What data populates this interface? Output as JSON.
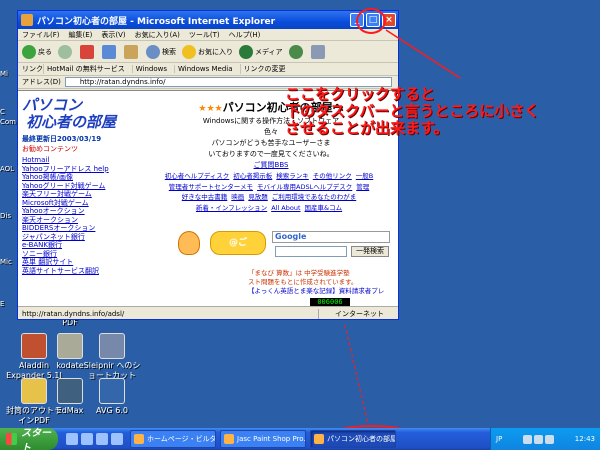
{
  "desktop": {
    "edge_labels": [
      "Mi",
      "C",
      "Com",
      "AOL",
      "Dis",
      "Mic",
      "E"
    ],
    "icons": [
      {
        "label": "Aladdin\nExpander 5.1J",
        "color": "#c05030"
      },
      {
        "label": "kodate",
        "color": "#aaaa99"
      },
      {
        "label": "Sleipnir へのシ\nョートカット",
        "color": "#7788aa"
      },
      {
        "label": "封筒のアウトラ\nインPDF",
        "color": "#e6c24a"
      },
      {
        "label": "EdMax",
        "color": "#406080"
      },
      {
        "label": "AVG 6.0",
        "color": "#3366aa"
      },
      {
        "label": "PDF",
        "color": "#cc3333"
      }
    ]
  },
  "window": {
    "title": "パソコン初心者の部屋 - Microsoft Internet Explorer",
    "minimize": "_",
    "maximize": "□",
    "close": "×",
    "menus": [
      "ファイル(F)",
      "編集(E)",
      "表示(V)",
      "お気に入り(A)",
      "ツール(T)",
      "ヘルプ(H)"
    ],
    "toolbar": {
      "back": "戻る",
      "search": "検索",
      "favorites": "お気に入り",
      "media": "メディア"
    },
    "links_label": "リンク",
    "links": [
      "HotMail の無料サービス",
      "Windows",
      "Windows Media",
      "リンクの変更"
    ],
    "address_label": "アドレス(D)",
    "address": "http://ratan.dyndns.info/",
    "status_url": "http://ratan.dyndns.info/adsl/",
    "status_zone": "インターネット"
  },
  "page": {
    "logo_line1": "パソコン",
    "logo_line2": "初心者の部屋",
    "updated": "最終更新日2003/03/19",
    "recommend": "お勧めコンテンツ",
    "left_links": [
      "Hotmail",
      "Yahooフリーアドレス",
      "Yahoo掲帳/画像",
      "Yahooグリード対戦ゲーム",
      "楽天フリー対戦ゲーム",
      "Microsoft対戦ゲーム",
      "Yahooオークション",
      "楽天オークション",
      "BIDDERSオークション",
      "ジャパンネット銀行",
      "e-BANK銀行",
      "ソニー銀行",
      "英単 翻訳サイト",
      "英語サイトサービス翻訳"
    ],
    "help_link": "help",
    "site_title": "パソコン初心者の部屋へ",
    "desc1": "Windowsに関する操作方法・ソフトウェア",
    "desc2": "色々",
    "desc3": "パソコンがどうも苦手なユーザーさま",
    "desc4": "いておりますので一度見てくださいね。",
    "qa_link": "ご質問BBS",
    "rlinks1": [
      "初心者ヘルプディスク",
      "初心者掲示板",
      "検索ランキ",
      "その他リンク",
      "一般B"
    ],
    "rlinks2": [
      "管理者サポートセンターメモ",
      "モバイル専用ADSLヘルプデスク",
      "管理"
    ],
    "rlinks3": [
      "好きな中古書籍",
      "映画",
      "見放題",
      "ご利用環境であなたのわがま"
    ],
    "rlinks4": [
      "新着・インフレッション",
      "All About",
      "国産車&コム"
    ],
    "banner": "@ご",
    "google_logo": "Google",
    "search_button": "一発検索",
    "ad1": "「まなび 算数」は 中学受験進学塾",
    "ad2": "スト問題をもとに作成されています。",
    "ad3": "【よっくん英語とま楽な記録】資料請求者プレ",
    "counter": "006006"
  },
  "annotation": {
    "line1": "ここをクリックすると",
    "line2": "下のタスクバーと言うところに小さく",
    "line3": "させることが出来ます。",
    "color": "#ff1a1a"
  },
  "taskbar": {
    "start": "スタート",
    "tasks": [
      {
        "label": "ホームページ・ビルダー...",
        "active": false
      },
      {
        "label": "Jasc Paint Shop Pro...",
        "active": false
      },
      {
        "label": "パソコン初心者の部屋",
        "active": true
      }
    ],
    "ime": "JP",
    "clock": "12:43"
  }
}
